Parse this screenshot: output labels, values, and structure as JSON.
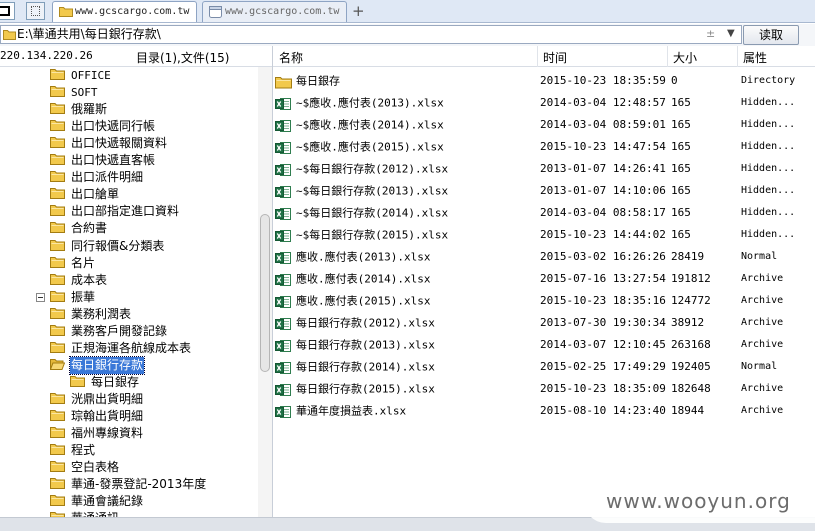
{
  "tabs": [
    {
      "label": "www.gcscargo.com.tw",
      "active": true
    },
    {
      "label": "www.gcscargo.com.tw",
      "active": false
    }
  ],
  "new_tab_label": "+",
  "address": {
    "path": "E:\\華通共用\\每日銀行存款\\",
    "pin_glyph": "±",
    "dropdown_glyph": "▼",
    "read_button": "读取"
  },
  "left_panel": {
    "ip": "220.134.220.26",
    "count": "目录(1),文件(15)"
  },
  "tree": [
    {
      "label": "OFFICE",
      "mono": true
    },
    {
      "label": "SOFT",
      "mono": true
    },
    {
      "label": "俄羅斯"
    },
    {
      "label": "出口快遞同行帳"
    },
    {
      "label": "出口快遞報關資料"
    },
    {
      "label": "出口快遞直客帳"
    },
    {
      "label": "出口派件明細"
    },
    {
      "label": "出口艙單"
    },
    {
      "label": "出口部指定進口資料"
    },
    {
      "label": "合約書"
    },
    {
      "label": "同行報價&分類表"
    },
    {
      "label": "名片"
    },
    {
      "label": "成本表"
    },
    {
      "label": "振華"
    },
    {
      "label": "業務利潤表"
    },
    {
      "label": "業務客戶開發記錄"
    },
    {
      "label": "正規海運各航線成本表"
    },
    {
      "label": "每日銀行存款",
      "selected": true,
      "open": true
    },
    {
      "label": "每日銀存",
      "child": true
    },
    {
      "label": "洸鼎出貨明細"
    },
    {
      "label": "琮翰出貨明細"
    },
    {
      "label": "福州專線資料"
    },
    {
      "label": "程式"
    },
    {
      "label": "空白表格"
    },
    {
      "label": "華通-發票登記-2013年度"
    },
    {
      "label": "華通會議紀錄"
    },
    {
      "label": "華通通訊"
    }
  ],
  "columns": {
    "name": "名称",
    "time": "时间",
    "size": "大小",
    "attr": "属性"
  },
  "files": [
    {
      "name": "每日銀存",
      "time": "2015-10-23 18:35:59",
      "size": "0",
      "attr": "Directory",
      "icon": "folder-icon"
    },
    {
      "name": "~$應收.應付表(2013).xlsx",
      "time": "2014-03-04 12:48:57",
      "size": "165",
      "attr": "Hidden...",
      "icon": "excel-icon"
    },
    {
      "name": "~$應收.應付表(2014).xlsx",
      "time": "2014-03-04 08:59:01",
      "size": "165",
      "attr": "Hidden...",
      "icon": "excel-icon"
    },
    {
      "name": "~$應收.應付表(2015).xlsx",
      "time": "2015-10-23 14:47:54",
      "size": "165",
      "attr": "Hidden...",
      "icon": "excel-icon"
    },
    {
      "name": "~$每日銀行存款(2012).xlsx",
      "time": "2013-01-07 14:26:41",
      "size": "165",
      "attr": "Hidden...",
      "icon": "excel-icon"
    },
    {
      "name": "~$每日銀行存款(2013).xlsx",
      "time": "2013-01-07 14:10:06",
      "size": "165",
      "attr": "Hidden...",
      "icon": "excel-icon"
    },
    {
      "name": "~$每日銀行存款(2014).xlsx",
      "time": "2014-03-04 08:58:17",
      "size": "165",
      "attr": "Hidden...",
      "icon": "excel-icon"
    },
    {
      "name": "~$每日銀行存款(2015).xlsx",
      "time": "2015-10-23 14:44:02",
      "size": "165",
      "attr": "Hidden...",
      "icon": "excel-icon"
    },
    {
      "name": "應收.應付表(2013).xlsx",
      "time": "2015-03-02 16:26:26",
      "size": "28419",
      "attr": "Normal",
      "icon": "excel-icon"
    },
    {
      "name": "應收.應付表(2014).xlsx",
      "time": "2015-07-16 13:27:54",
      "size": "191812",
      "attr": "Archive",
      "icon": "excel-icon"
    },
    {
      "name": "應收.應付表(2015).xlsx",
      "time": "2015-10-23 18:35:16",
      "size": "124772",
      "attr": "Archive",
      "icon": "excel-icon"
    },
    {
      "name": "每日銀行存款(2012).xlsx",
      "time": "2013-07-30 19:30:34",
      "size": "38912",
      "attr": "Archive",
      "icon": "excel-icon"
    },
    {
      "name": "每日銀行存款(2013).xlsx",
      "time": "2014-03-07 12:10:45",
      "size": "263168",
      "attr": "Archive",
      "icon": "excel-icon"
    },
    {
      "name": "每日銀行存款(2014).xlsx",
      "time": "2015-02-25 17:49:29",
      "size": "192405",
      "attr": "Normal",
      "icon": "excel-icon"
    },
    {
      "name": "每日銀行存款(2015).xlsx",
      "time": "2015-10-23 18:35:09",
      "size": "182648",
      "attr": "Archive",
      "icon": "excel-icon"
    },
    {
      "name": "華通年度損益表.xlsx",
      "time": "2015-08-10 14:23:40",
      "size": "18944",
      "attr": "Archive",
      "icon": "excel-icon"
    }
  ],
  "watermark": "www.wooyun.org",
  "colors": {
    "selection": "#3a78d8",
    "folder": "#f2c94c",
    "excel": "#1e7145"
  }
}
